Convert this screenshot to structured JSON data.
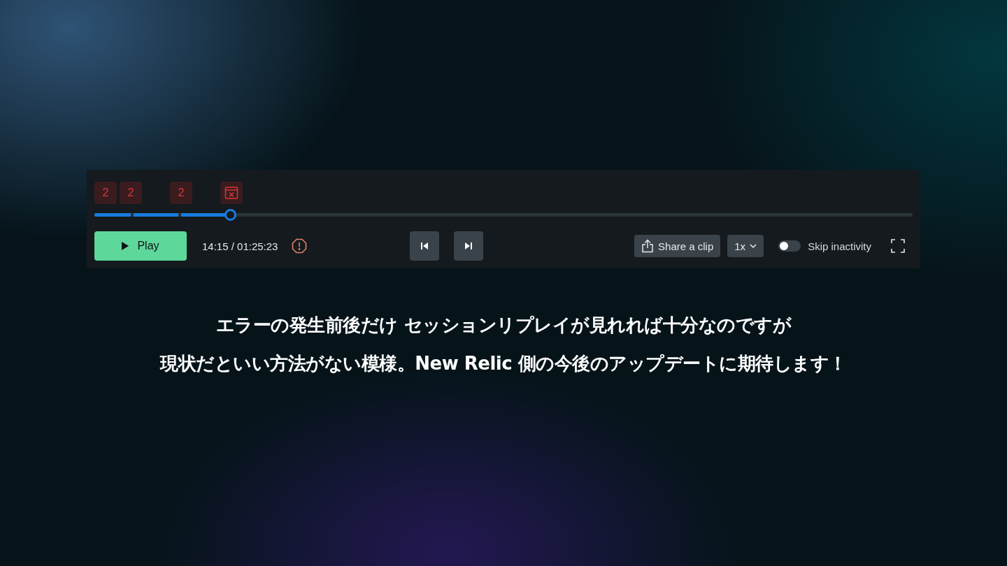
{
  "player": {
    "markers": [
      {
        "kind": "count",
        "label": "2"
      },
      {
        "kind": "count",
        "label": "2"
      },
      {
        "kind": "count",
        "label": "2"
      },
      {
        "kind": "error"
      }
    ],
    "progress": {
      "level": 0.166
    },
    "play_button": {
      "label": "Play"
    },
    "time": "14:15 / 01:25:23",
    "share_button": {
      "label": "Share a clip"
    },
    "speed": {
      "label": "1x"
    },
    "skip_inactivity": {
      "label": "Skip inactivity",
      "on": false
    }
  },
  "caption": [
    "エラーの発生前後だけ セッションリプレイが見れれば十分なのですが",
    "現状だといい方法がない模様。New Relic 側の今後のアップデートに期待します！"
  ]
}
